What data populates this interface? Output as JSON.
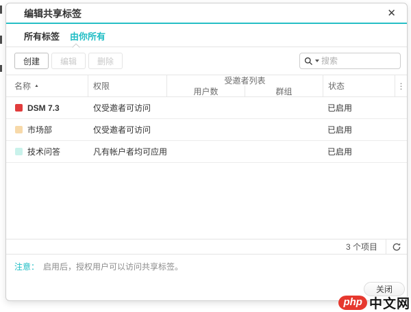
{
  "dialog": {
    "title": "编辑共享标签",
    "close_glyph": "✕"
  },
  "tabs": {
    "all": {
      "label": "所有标签"
    },
    "owned": {
      "label": "由你所有"
    }
  },
  "toolbar": {
    "create_label": "创建",
    "edit_label": "编辑",
    "delete_label": "删除",
    "search_placeholder": "搜索",
    "search_value": ""
  },
  "table": {
    "header": {
      "name": "名称",
      "sort_glyph": "▲",
      "permission": "权限",
      "invitees": "受邀者列表",
      "users": "用户数",
      "groups": "群组",
      "status": "状态",
      "menu_glyph": "⋮"
    },
    "rows": [
      {
        "name": "DSM 7.3",
        "color": "#e13c3c",
        "permission": "仅受邀者可访问",
        "users": "",
        "groups": "",
        "status": "已启用"
      },
      {
        "name": "市场部",
        "color": "#f7d9a9",
        "permission": "仅受邀者可访问",
        "users": "",
        "groups": "",
        "status": "已启用"
      },
      {
        "name": "技术问答",
        "color": "#c9f2eb",
        "permission": "凡有帐户者均可应用",
        "users": "",
        "groups": "",
        "status": "已启用"
      }
    ]
  },
  "pager": {
    "count": "3 个项目"
  },
  "note": {
    "label": "注意：",
    "text": "启用后，授权用户可以访问共享标签。"
  },
  "footer": {
    "close_label": "关闭"
  },
  "watermark": {
    "badge": "php",
    "text": "中文网",
    "badge_color": "#e6382e"
  },
  "colors": {
    "accent": "#1fbdc4"
  }
}
